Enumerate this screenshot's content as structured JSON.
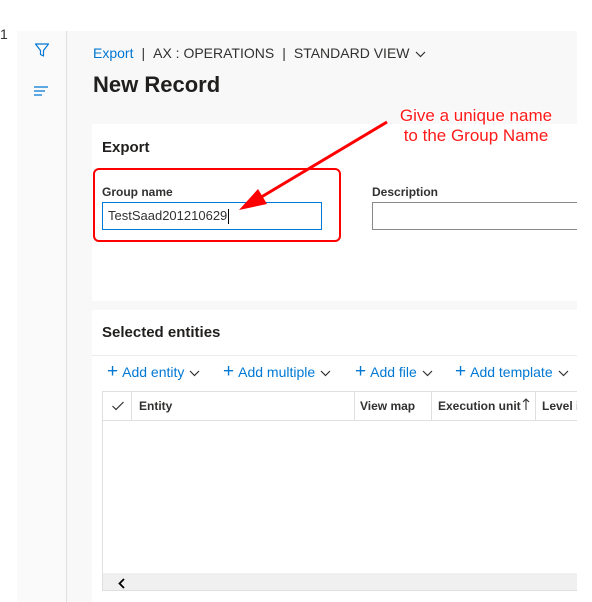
{
  "left_glyph": "1",
  "breadcrumb": {
    "link": "Export",
    "company": "AX : OPERATIONS",
    "view": "STANDARD VIEW"
  },
  "page_title": "New Record",
  "export_section": {
    "title": "Export",
    "group_name": {
      "label": "Group name",
      "value": "TestSaad201210629"
    },
    "description": {
      "label": "Description",
      "value": ""
    }
  },
  "entities_section": {
    "title": "Selected entities",
    "toolbar": [
      "Add entity",
      "Add multiple",
      "Add file",
      "Add template"
    ],
    "columns": [
      "Entity",
      "View map",
      "Execution unit",
      "Level i"
    ]
  },
  "annotation": {
    "line1": "Give a unique name",
    "line2": "to the Group Name"
  },
  "colors": {
    "accent": "#0078d4",
    "annotation": "#ff0000"
  },
  "icons": [
    "filter-icon",
    "menu-icon",
    "chevron-down-icon",
    "plus-icon",
    "checkmark-icon",
    "sort-up-icon",
    "chevron-left-icon"
  ]
}
